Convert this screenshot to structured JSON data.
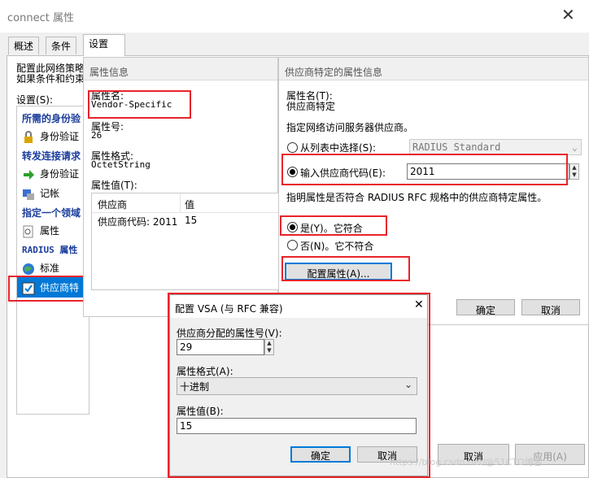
{
  "window": {
    "title": "connect 属性",
    "tabs": [
      "概述",
      "条件",
      "设置"
    ]
  },
  "intro": {
    "line1": "配置此网络策略",
    "line2": "如果条件和约束"
  },
  "settings": {
    "label": "设置(S):",
    "headers": {
      "required_auth": "所需的身份验",
      "forwarding": "转发连接请求",
      "specify": "指定一个领域",
      "radius": "RADIUS 属性"
    },
    "items": {
      "auth1": "身份验证",
      "auth2": "身份验证",
      "accounting": "记帐",
      "attribute": "属性",
      "standard": "标准",
      "vendor": "供应商特"
    }
  },
  "attr_info": {
    "header": "属性信息",
    "name_label": "属性名:",
    "name_value": "Vendor-Specific",
    "number_label": "属性号:",
    "number_value": "26",
    "format_label": "属性格式:",
    "format_value": "OctetString",
    "value_label": "属性值(T):",
    "table": {
      "columns": [
        "供应商",
        "值"
      ],
      "rows": [
        [
          "供应商代码: 2011",
          "15"
        ]
      ]
    }
  },
  "vendor_info": {
    "header": "供应商特定的属性信息",
    "name_label": "属性名(T):",
    "name_value": "供应商特定",
    "specify_text": "指定网络访问服务器供应商。",
    "radio_list_label": "从列表中选择(S):",
    "list_value": "RADIUS Standard",
    "radio_code_label": "输入供应商代码(E):",
    "code_value": "2011",
    "conform_text": "指明属性是否符合 RADIUS RFC 规格中的供应商特定属性。",
    "yes_label": "是(Y)。它符合",
    "no_label": "否(N)。它不符合",
    "configure_button": "配置属性(A)...",
    "ok": "确定",
    "cancel": "取消"
  },
  "vsa_dialog": {
    "title": "配置 VSA (与 RFC 兼容)",
    "assigned_label": "供应商分配的属性号(V):",
    "assigned_value": "29",
    "format_label": "属性格式(A):",
    "format_value": "十进制",
    "value_label": "属性值(B):",
    "value_value": "15",
    "ok": "确定",
    "cancel": "取消"
  },
  "main_buttons": {
    "cancel": "取消",
    "apply": "应用(A)"
  },
  "watermark": "https://blog.csdn.net/@51CTO博客",
  "colors": {
    "highlight": "#e8242b",
    "selection": "#0078d7",
    "header_blue": "#1b3d9c"
  }
}
